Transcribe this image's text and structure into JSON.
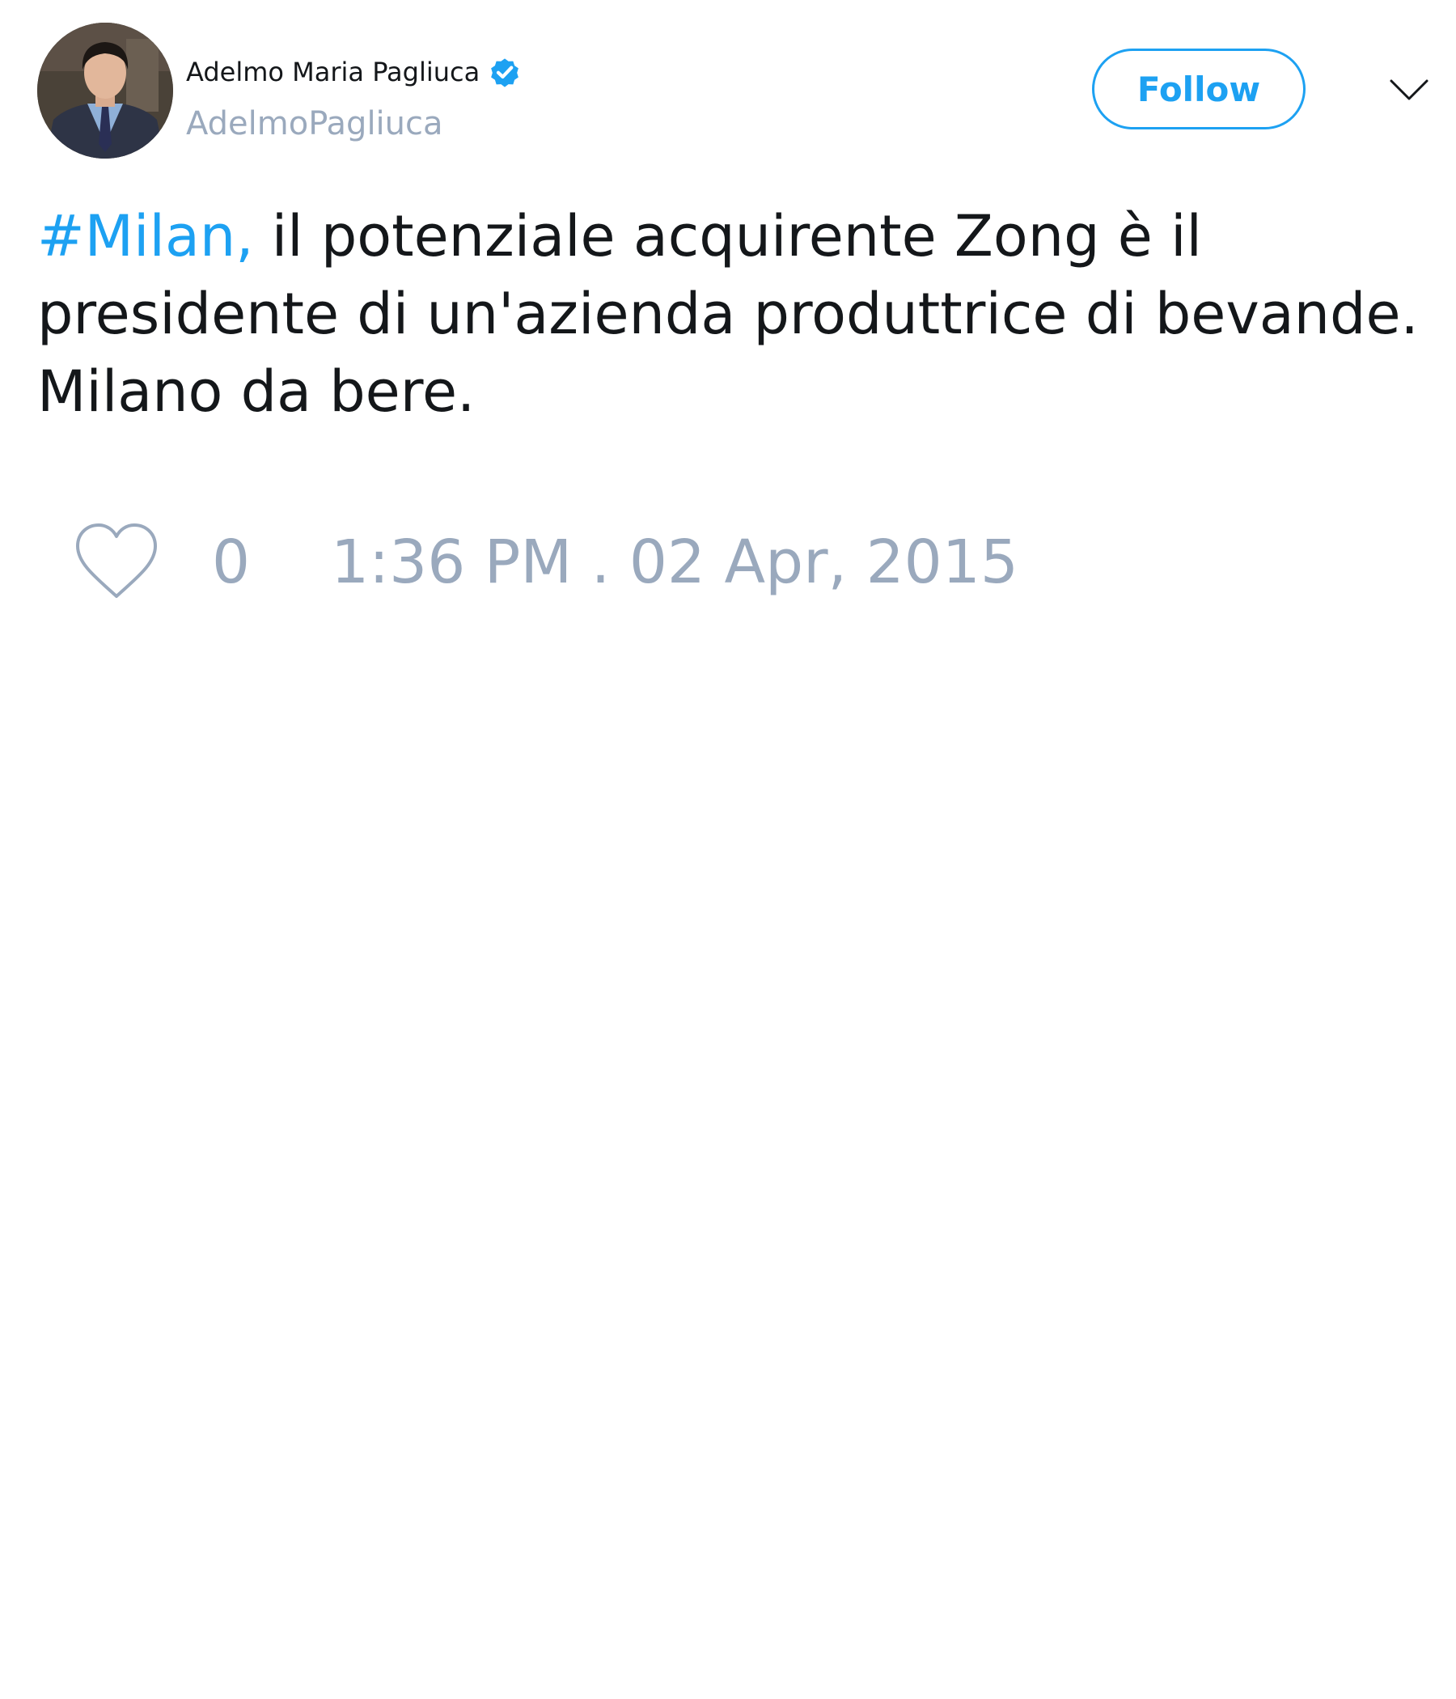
{
  "author": {
    "display_name": "Adelmo Maria Pagliuca",
    "handle": "AdelmoPagliuca",
    "verified_icon": "verified-badge-icon"
  },
  "actions": {
    "follow_label": "Follow",
    "menu_icon": "chevron-down-icon"
  },
  "tweet": {
    "hashtag": "#Milan,",
    "text": " il potenziale acquirente Zong è il presidente di un'azienda produttrice di bevande. Milano da bere."
  },
  "footer": {
    "like_icon": "heart-icon",
    "like_count": "0",
    "timestamp": "1:36 PM . 02 Apr, 2015"
  },
  "colors": {
    "accent": "#1da1f2",
    "muted": "#9aa9bd",
    "text": "#14171a"
  }
}
